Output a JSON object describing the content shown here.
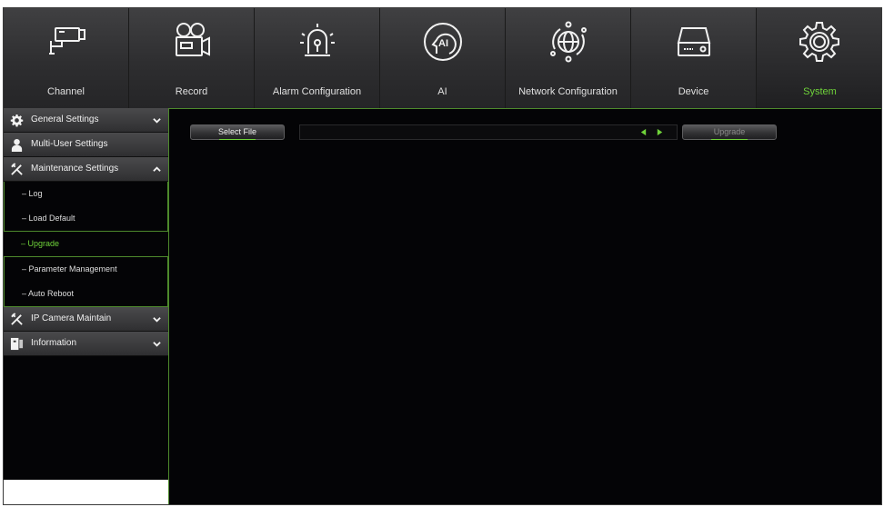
{
  "top_menu": {
    "items": [
      {
        "label": "Channel",
        "icon": "cctv-camera-icon"
      },
      {
        "label": "Record",
        "icon": "video-camera-icon"
      },
      {
        "label": "Alarm Configuration",
        "icon": "alarm-siren-icon"
      },
      {
        "label": "AI",
        "icon": "ai-head-icon"
      },
      {
        "label": "Network Configuration",
        "icon": "globe-network-icon"
      },
      {
        "label": "Device",
        "icon": "hdd-device-icon"
      },
      {
        "label": "System",
        "icon": "gear-icon"
      }
    ],
    "active": "System",
    "active_color": "#6fd33a"
  },
  "sidebar": {
    "general_settings": "General Settings",
    "multi_user_settings": "Multi-User Settings",
    "maintenance_settings": "Maintenance Settings",
    "maintenance_items": {
      "log": "Log",
      "load_default": "Load Default",
      "upgrade": "Upgrade",
      "parameter_management": "Parameter Management",
      "auto_reboot": "Auto Reboot"
    },
    "ip_camera_maintain": "IP Camera Maintain",
    "information": "Information",
    "active_item": "Upgrade"
  },
  "upgrade_panel": {
    "select_file_label": "Select File",
    "file_path": "",
    "upgrade_label": "Upgrade"
  },
  "colors": {
    "accent": "#6fd33a",
    "border_accent": "#4e8a2c",
    "background": "#040406"
  }
}
